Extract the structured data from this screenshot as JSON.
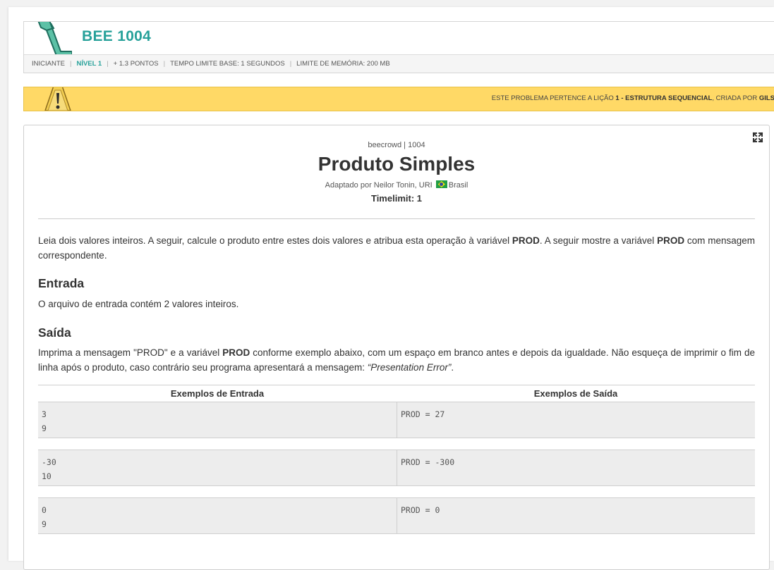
{
  "problem": {
    "code": "BEE 1004",
    "meta": [
      "INICIANTE",
      "NÍVEL 1",
      "+ 1.3 PONTOS",
      "TEMPO LIMITE BASE: 1 SEGUNDOS",
      "LIMITE DE MEMÓRIA: 200 MB"
    ]
  },
  "notice": {
    "prefix": "ESTE PROBLEMA PERTENCE A LIÇÃO ",
    "lesson": "1 - ESTRUTURA SEQUENCIAL",
    "middle": ", CRIADA POR ",
    "author": "GILS"
  },
  "content": {
    "breadcrumb": "beecrowd | 1004",
    "title": "Produto Simples",
    "author_prefix": "Adaptado por Neilor Tonin, URI",
    "author_country": "Brasil",
    "timelimit": "Timelimit: 1",
    "description": {
      "part1": "Leia dois valores inteiros. A seguir, calcule o produto entre estes dois valores e atribua esta operação à variável ",
      "bold1": "PROD",
      "part2": ". A seguir mostre a variável ",
      "bold2": "PROD",
      "part3": " com mensagem correspondente."
    },
    "input_heading": "Entrada",
    "input_text": "O arquivo de entrada contém 2 valores inteiros.",
    "output_heading": "Saída",
    "output": {
      "part1": "Imprima a mensagem \"PROD\" e a variável ",
      "bold": "PROD",
      "part2": " conforme exemplo abaixo, com um espaço em branco antes e depois da igualdade. Não esqueça de imprimir o fim de linha após o produto, caso contrário seu programa apresentará a mensagem: ",
      "italic": "“Presentation Error”",
      "part3": "."
    },
    "examples_input_header": "Exemplos de Entrada",
    "examples_output_header": "Exemplos de Saída",
    "examples": [
      {
        "input": "3\n9",
        "output": "PROD = 27"
      },
      {
        "input": "-30\n10",
        "output": "PROD = -300"
      },
      {
        "input": "0\n9",
        "output": "PROD = 0"
      }
    ]
  },
  "icons": {
    "logo": "bee-logo-icon",
    "warning": "warning-icon",
    "expand": "expand-icon"
  },
  "colors": {
    "accent": "#27a19a",
    "notice_bg": "#ffd966",
    "example_bg": "#ededed"
  }
}
